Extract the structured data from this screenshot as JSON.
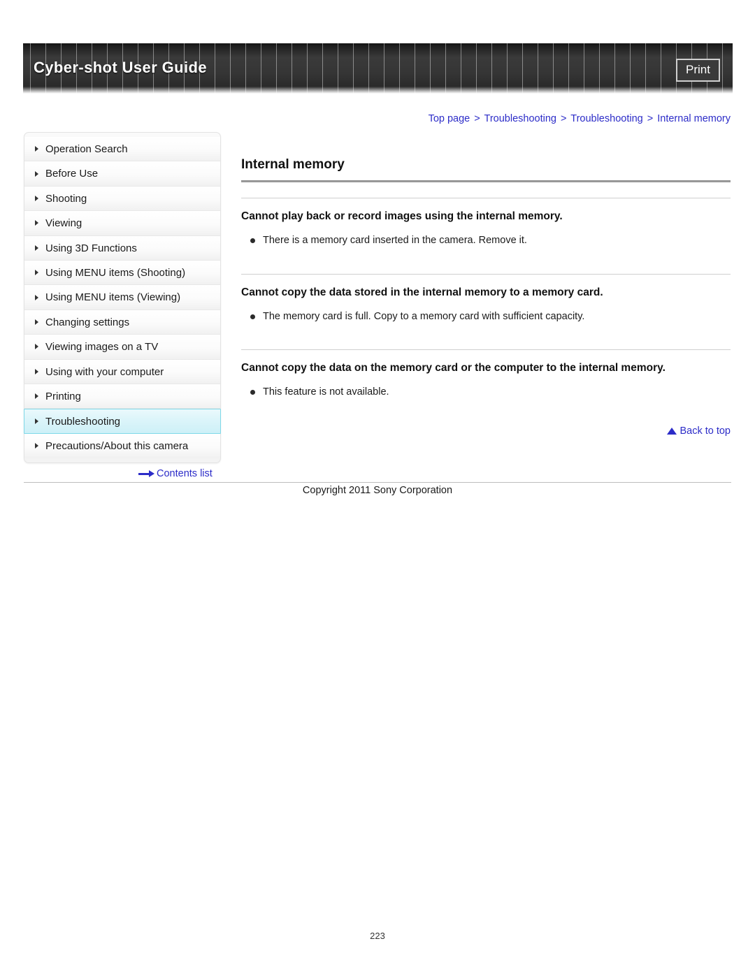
{
  "header": {
    "title": "Cyber-shot User Guide",
    "print_label": "Print"
  },
  "breadcrumb": {
    "items": [
      "Top page",
      "Troubleshooting",
      "Troubleshooting",
      "Internal memory"
    ],
    "separator": ">"
  },
  "sidebar": {
    "items": [
      {
        "label": "Operation Search",
        "active": false
      },
      {
        "label": "Before Use",
        "active": false
      },
      {
        "label": "Shooting",
        "active": false
      },
      {
        "label": "Viewing",
        "active": false
      },
      {
        "label": "Using 3D Functions",
        "active": false
      },
      {
        "label": "Using MENU items (Shooting)",
        "active": false
      },
      {
        "label": "Using MENU items (Viewing)",
        "active": false
      },
      {
        "label": "Changing settings",
        "active": false
      },
      {
        "label": "Viewing images on a TV",
        "active": false
      },
      {
        "label": "Using with your computer",
        "active": false
      },
      {
        "label": "Printing",
        "active": false
      },
      {
        "label": "Troubleshooting",
        "active": true
      },
      {
        "label": "Precautions/About this camera",
        "active": false
      }
    ],
    "contents_list_label": "Contents list"
  },
  "main": {
    "page_title": "Internal memory",
    "sections": [
      {
        "heading": "Cannot play back or record images using the internal memory.",
        "bullets": [
          "There is a memory card inserted in the camera. Remove it."
        ]
      },
      {
        "heading": "Cannot copy the data stored in the internal memory to a memory card.",
        "bullets": [
          "The memory card is full. Copy to a memory card with sufficient capacity."
        ]
      },
      {
        "heading": "Cannot copy the data on the memory card or the computer to the internal memory.",
        "bullets": [
          "This feature is not available."
        ]
      }
    ],
    "back_to_top_label": "Back to top"
  },
  "footer": {
    "copyright": "Copyright 2011 Sony Corporation",
    "page_number": "223"
  },
  "colors": {
    "link_blue": "#2c2cc8",
    "header_dark": "#2e2e2e",
    "active_cyan": "#7fd8e8"
  }
}
